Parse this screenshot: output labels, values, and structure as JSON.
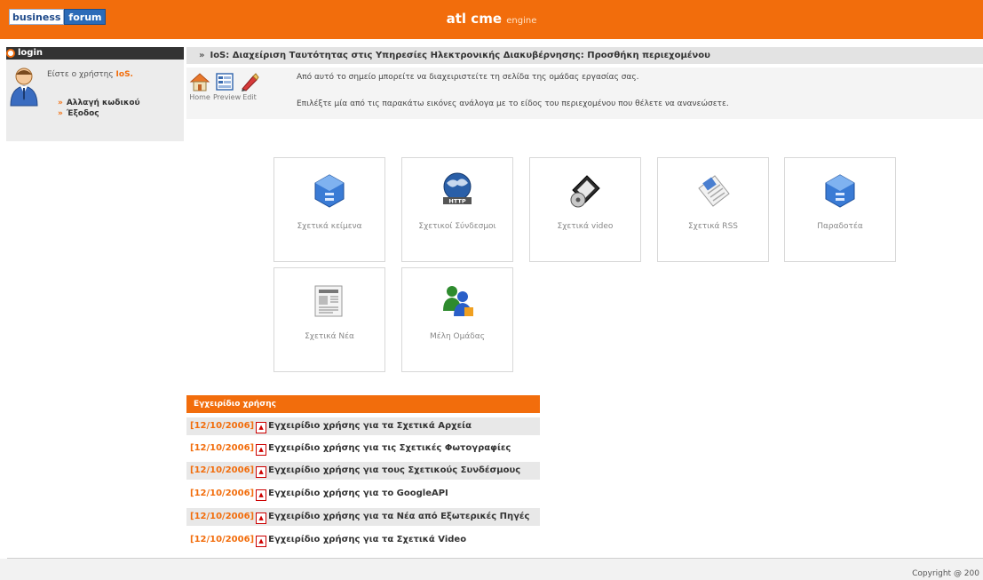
{
  "header": {
    "logo_left": "business",
    "logo_right": "forum",
    "brand": "atl cme",
    "brand_suffix": "engine",
    "accent": "#f26d0c"
  },
  "login": {
    "title": "login",
    "welcome_prefix": "Είστε ο χρήστης",
    "username": "IoS.",
    "links": [
      "Αλλαγή κωδικού",
      "Έξοδος"
    ]
  },
  "breadcrumb": {
    "text": "IoS: Διαχείριση Ταυτότητας στις Υπηρεσίες Ηλεκτρονικής Διακυβέρνησης: Προσθήκη περιεχομένου"
  },
  "toolbar": {
    "buttons": [
      "Home",
      "Preview",
      "Edit"
    ],
    "hint1": "Από αυτό το σημείο μπορείτε να διαχειριστείτε τη σελίδα της ομάδας εργασίας σας.",
    "hint2": "Επιλέξτε μία από τις παρακάτω εικόνες ανάλογα με το είδος του περιεχομένου που θέλετε να ανανεώσετε."
  },
  "tiles": [
    {
      "label": "Σχετικά κείμενα",
      "icon": "cabinet-icon"
    },
    {
      "label": "Σχετικοί Σύνδεσμοι",
      "icon": "globe-http-icon"
    },
    {
      "label": "Σχετικά video",
      "icon": "film-reel-icon"
    },
    {
      "label": "Σχετικά RSS",
      "icon": "rss-newspaper-icon"
    },
    {
      "label": "Παραδοτέα",
      "icon": "cabinet-icon"
    },
    {
      "label": "Σχετικά Νέα",
      "icon": "newspaper-icon"
    },
    {
      "label": "Μέλη Ομάδας",
      "icon": "group-members-icon"
    }
  ],
  "manual": {
    "title": "Εγχειρίδιο χρήσης",
    "rows": [
      {
        "date": "[12/10/2006]",
        "title": "Εγχειρίδιο χρήσης για τα Σχετικά Αρχεία"
      },
      {
        "date": "[12/10/2006]",
        "title": "Εγχειρίδιο χρήσης για τις Σχετικές Φωτογραφίες"
      },
      {
        "date": "[12/10/2006]",
        "title": "Εγχειρίδιο χρήσης για τους Σχετικούς Συνδέσμους"
      },
      {
        "date": "[12/10/2006]",
        "title": "Εγχειρίδιο χρήσης για το GoogleAPI"
      },
      {
        "date": "[12/10/2006]",
        "title": "Εγχειρίδιο χρήσης για τα Νέα από Εξωτερικές Πηγές"
      },
      {
        "date": "[12/10/2006]",
        "title": "Εγχειρίδιο χρήσης για τα Σχετικά Video"
      }
    ]
  },
  "footer": {
    "copyright": "Copyright @ 200"
  }
}
